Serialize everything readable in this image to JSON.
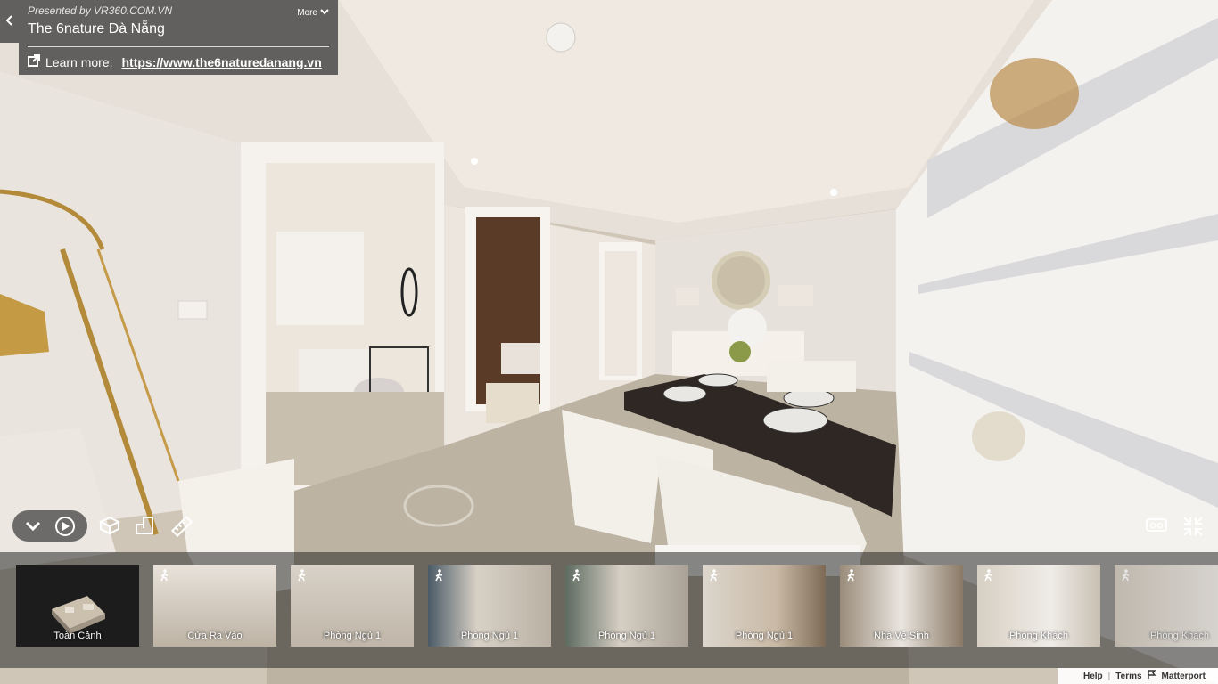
{
  "presented_by": "Presented by VR360.COM.VN",
  "more_label": "More",
  "title": "The 6nature Đà Nẵng",
  "learn_more_label": "Learn more:",
  "learn_more_url": "https://www.the6naturedanang.vn",
  "thumbnails": [
    {
      "label": "Toàn Cảnh",
      "type": "dollhouse"
    },
    {
      "label": "Cửa Ra Vào",
      "type": "pano"
    },
    {
      "label": "Phòng Ngủ 1",
      "type": "pano"
    },
    {
      "label": "Phòng Ngủ 1",
      "type": "pano"
    },
    {
      "label": "Phòng Ngủ 1",
      "type": "pano"
    },
    {
      "label": "Phòng Ngủ 1",
      "type": "pano"
    },
    {
      "label": "Nhà Vệ Sinh",
      "type": "pano"
    },
    {
      "label": "Phòng Khách",
      "type": "pano"
    },
    {
      "label": "Phòng Khách",
      "type": "pano"
    }
  ],
  "footer": {
    "help": "Help",
    "terms": "Terms",
    "brand": "Matterport"
  },
  "icons": [
    "chevron-left-icon",
    "chevron-down-icon",
    "play-icon",
    "dollhouse-icon",
    "floorplan-icon",
    "ruler-icon",
    "vr-headset-icon",
    "exit-fullscreen-icon",
    "walk-icon",
    "external-link-icon",
    "flag-icon"
  ]
}
